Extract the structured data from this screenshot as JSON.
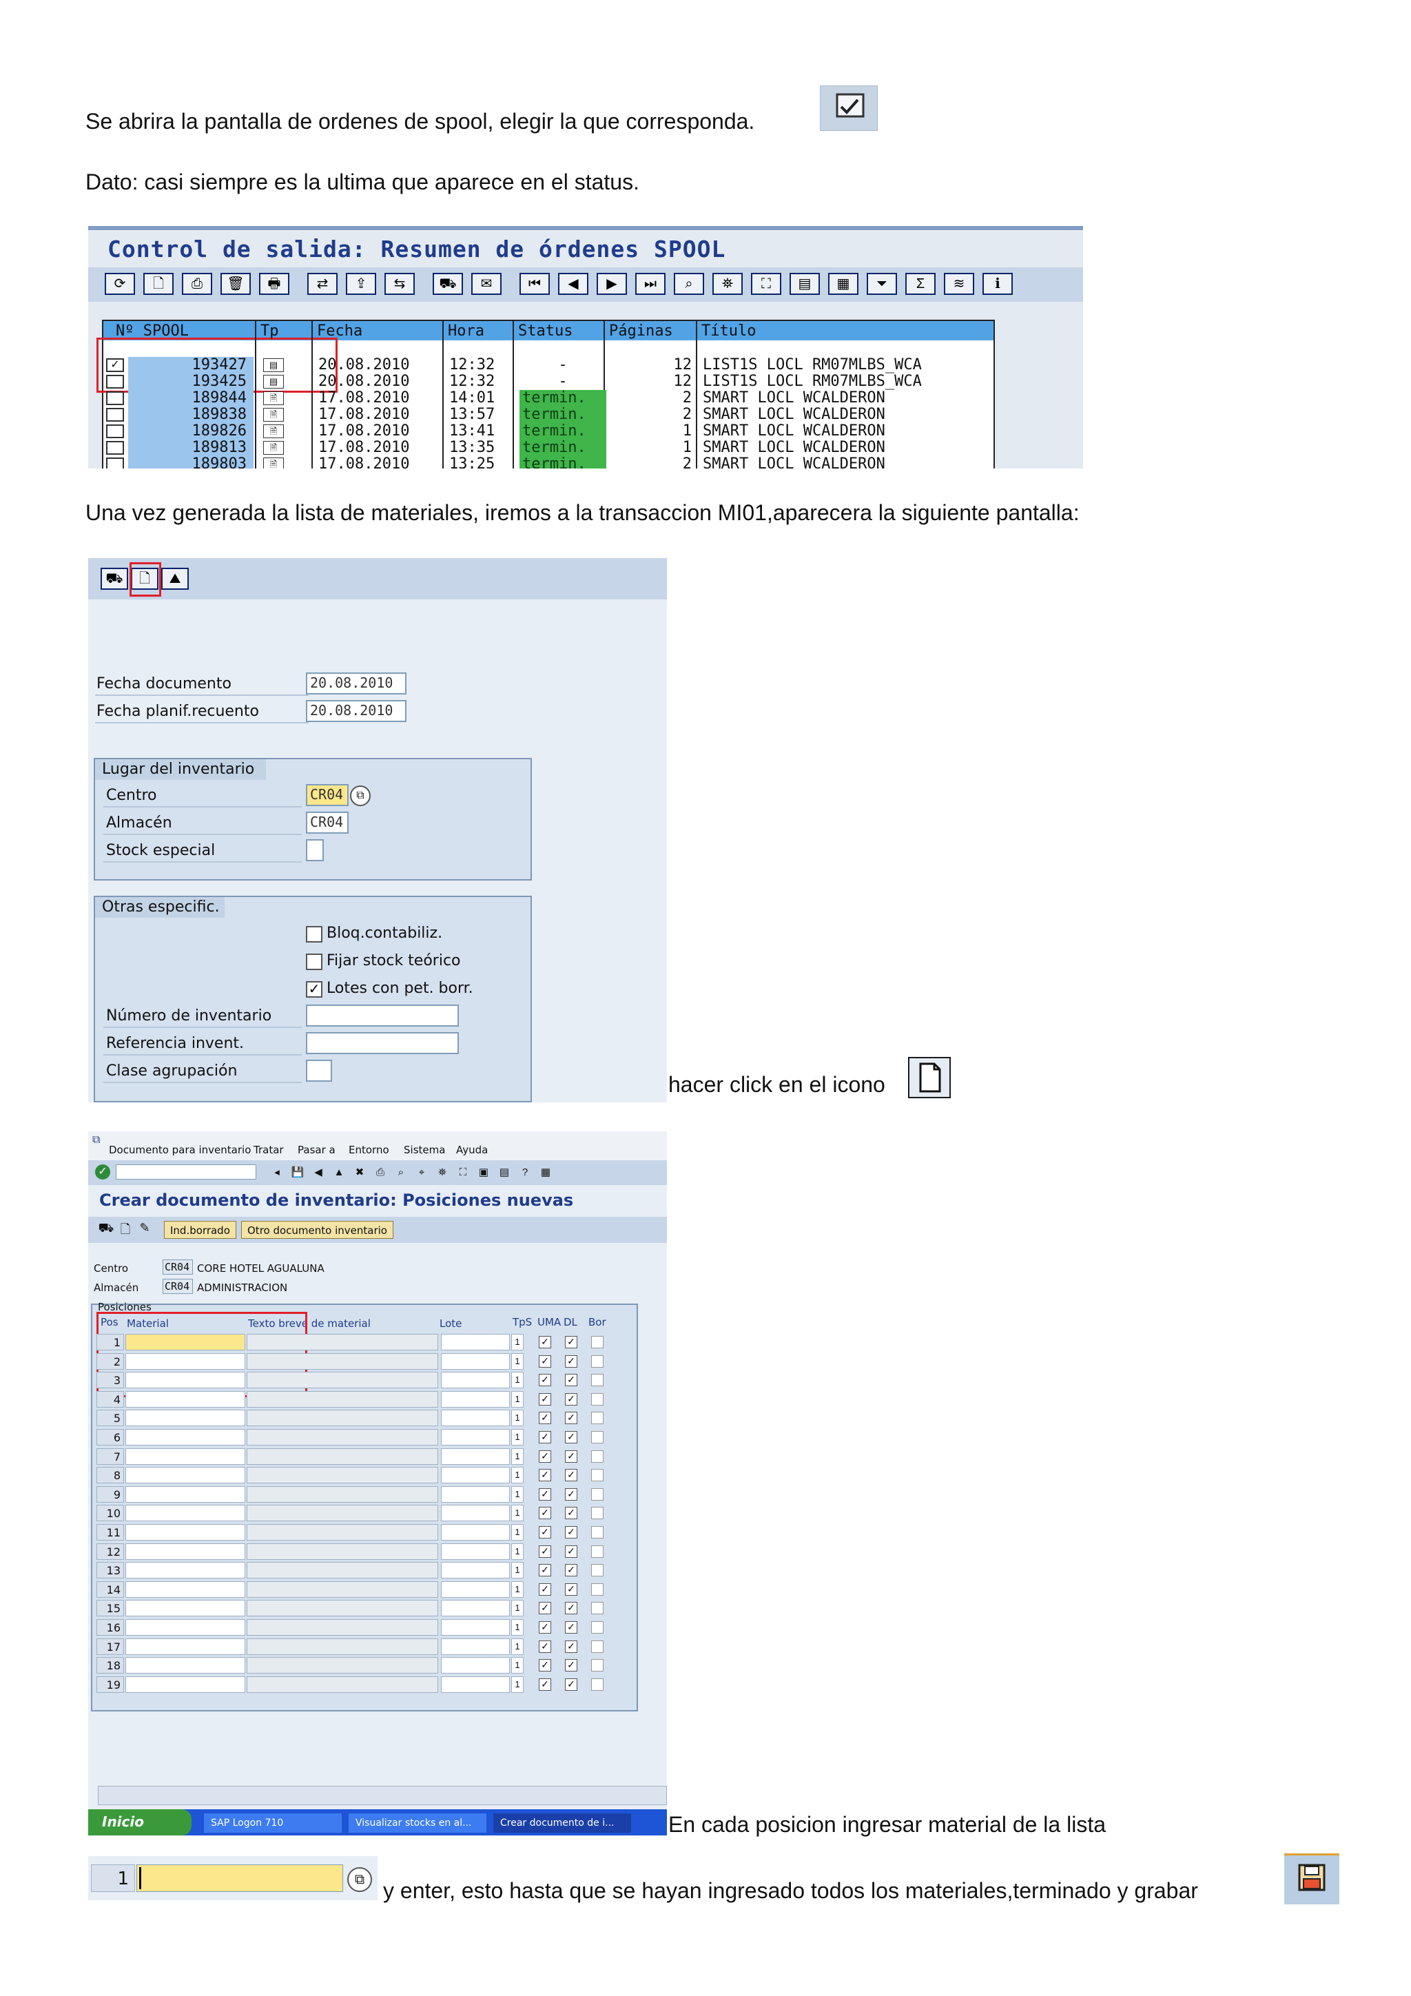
{
  "texts": {
    "p1": "Se abrira la pantalla de ordenes de spool, elegir la que corresponda.",
    "p2": "Dato: casi siempre es la ultima que aparece en el status.",
    "p3": "Una vez generada la lista de materiales, iremos a la transaccion MI01,aparecera la siguiente pantalla:",
    "p4": "hacer click en el icono",
    "p5": "En cada posicion ingresar material de la lista",
    "p6": "y enter, esto hasta que se hayan ingresado todos los materiales,terminado y grabar"
  },
  "spool": {
    "title": "Control de salida: Resumen de órdenes SPOOL",
    "headers": [
      "Nº SPOOL",
      "Tp",
      "Fecha",
      "Hora",
      "Status",
      "Páginas",
      "Título"
    ],
    "rows": [
      {
        "num": "193427",
        "fecha": "20.08.2010",
        "hora": "12:32",
        "status": "-",
        "paginas": "12",
        "titulo": "LIST1S LOCL RM07MLBS_WCA",
        "checked": true
      },
      {
        "num": "193425",
        "fecha": "20.08.2010",
        "hora": "12:32",
        "status": "-",
        "paginas": "12",
        "titulo": "LIST1S LOCL RM07MLBS_WCA",
        "checked": false
      },
      {
        "num": "189844",
        "fecha": "17.08.2010",
        "hora": "14:01",
        "status": "termin.",
        "paginas": "2",
        "titulo": "SMART LOCL WCALDERON",
        "checked": false
      },
      {
        "num": "189838",
        "fecha": "17.08.2010",
        "hora": "13:57",
        "status": "termin.",
        "paginas": "2",
        "titulo": "SMART LOCL WCALDERON",
        "checked": false
      },
      {
        "num": "189826",
        "fecha": "17.08.2010",
        "hora": "13:41",
        "status": "termin.",
        "paginas": "1",
        "titulo": "SMART LOCL WCALDERON",
        "checked": false
      },
      {
        "num": "189813",
        "fecha": "17.08.2010",
        "hora": "13:35",
        "status": "termin.",
        "paginas": "1",
        "titulo": "SMART LOCL WCALDERON",
        "checked": false
      },
      {
        "num": "189803",
        "fecha": "17.08.2010",
        "hora": "13:25",
        "status": "termin.",
        "paginas": "2",
        "titulo": "SMART LOCL WCALDERON",
        "checked": false
      }
    ]
  },
  "mi01": {
    "fecha_documento_label": "Fecha documento",
    "fecha_documento": "20.08.2010",
    "fecha_planif_label": "Fecha planif.recuento",
    "fecha_planif": "20.08.2010",
    "lugar_title": "Lugar del inventario",
    "centro_label": "Centro",
    "centro": "CR04",
    "almacen_label": "Almacén",
    "almacen": "CR04",
    "stock_label": "Stock especial",
    "otras_title": "Otras especific.",
    "bloq_label": "Bloq.contabiliz.",
    "fijar_label": "Fijar stock teórico",
    "lotes_label": "Lotes con pet. borr.",
    "numero_label": "Número de inventario",
    "referencia_label": "Referencia invent.",
    "clase_label": "Clase agrupación"
  },
  "crear": {
    "menu": [
      "Documento para inventario",
      "Tratar",
      "Pasar a",
      "Entorno",
      "Sistema",
      "Ayuda"
    ],
    "title": "Crear documento de inventario: Posiciones nuevas",
    "btn_ind": "Ind.borrado",
    "btn_otro": "Otro documento inventario",
    "centro_label": "Centro",
    "centro_code": "CR04",
    "centro_name": "CORE HOTEL AGUALUNA",
    "almacen_label": "Almacén",
    "almacen_code": "CR04",
    "almacen_name": "ADMINISTRACION",
    "posiciones": "Posiciones",
    "col_pos": "Pos",
    "col_material": "Material",
    "col_texto": "Texto breve de material",
    "col_lote": "Lote",
    "col_tps": "TpS",
    "col_uma": "UMA",
    "col_dl": "DL",
    "col_bor": "Bor",
    "positions": [
      "1",
      "2",
      "3",
      "4",
      "5",
      "6",
      "7",
      "8",
      "9",
      "10",
      "11",
      "12",
      "13",
      "14",
      "15",
      "16",
      "17",
      "18",
      "19"
    ],
    "tps_value": "1"
  },
  "taskbar": {
    "inicio": "Inicio",
    "items": [
      "SAP Logon 710",
      "Visualizar stocks en al...",
      "Crear documento de i..."
    ]
  },
  "snippet": {
    "pos": "1"
  },
  "colors": {
    "sap_blue": "#1f3c8c",
    "header_blue": "#52a3e6",
    "status_green": "#3fb54a",
    "highlight_red": "#e0202a"
  }
}
